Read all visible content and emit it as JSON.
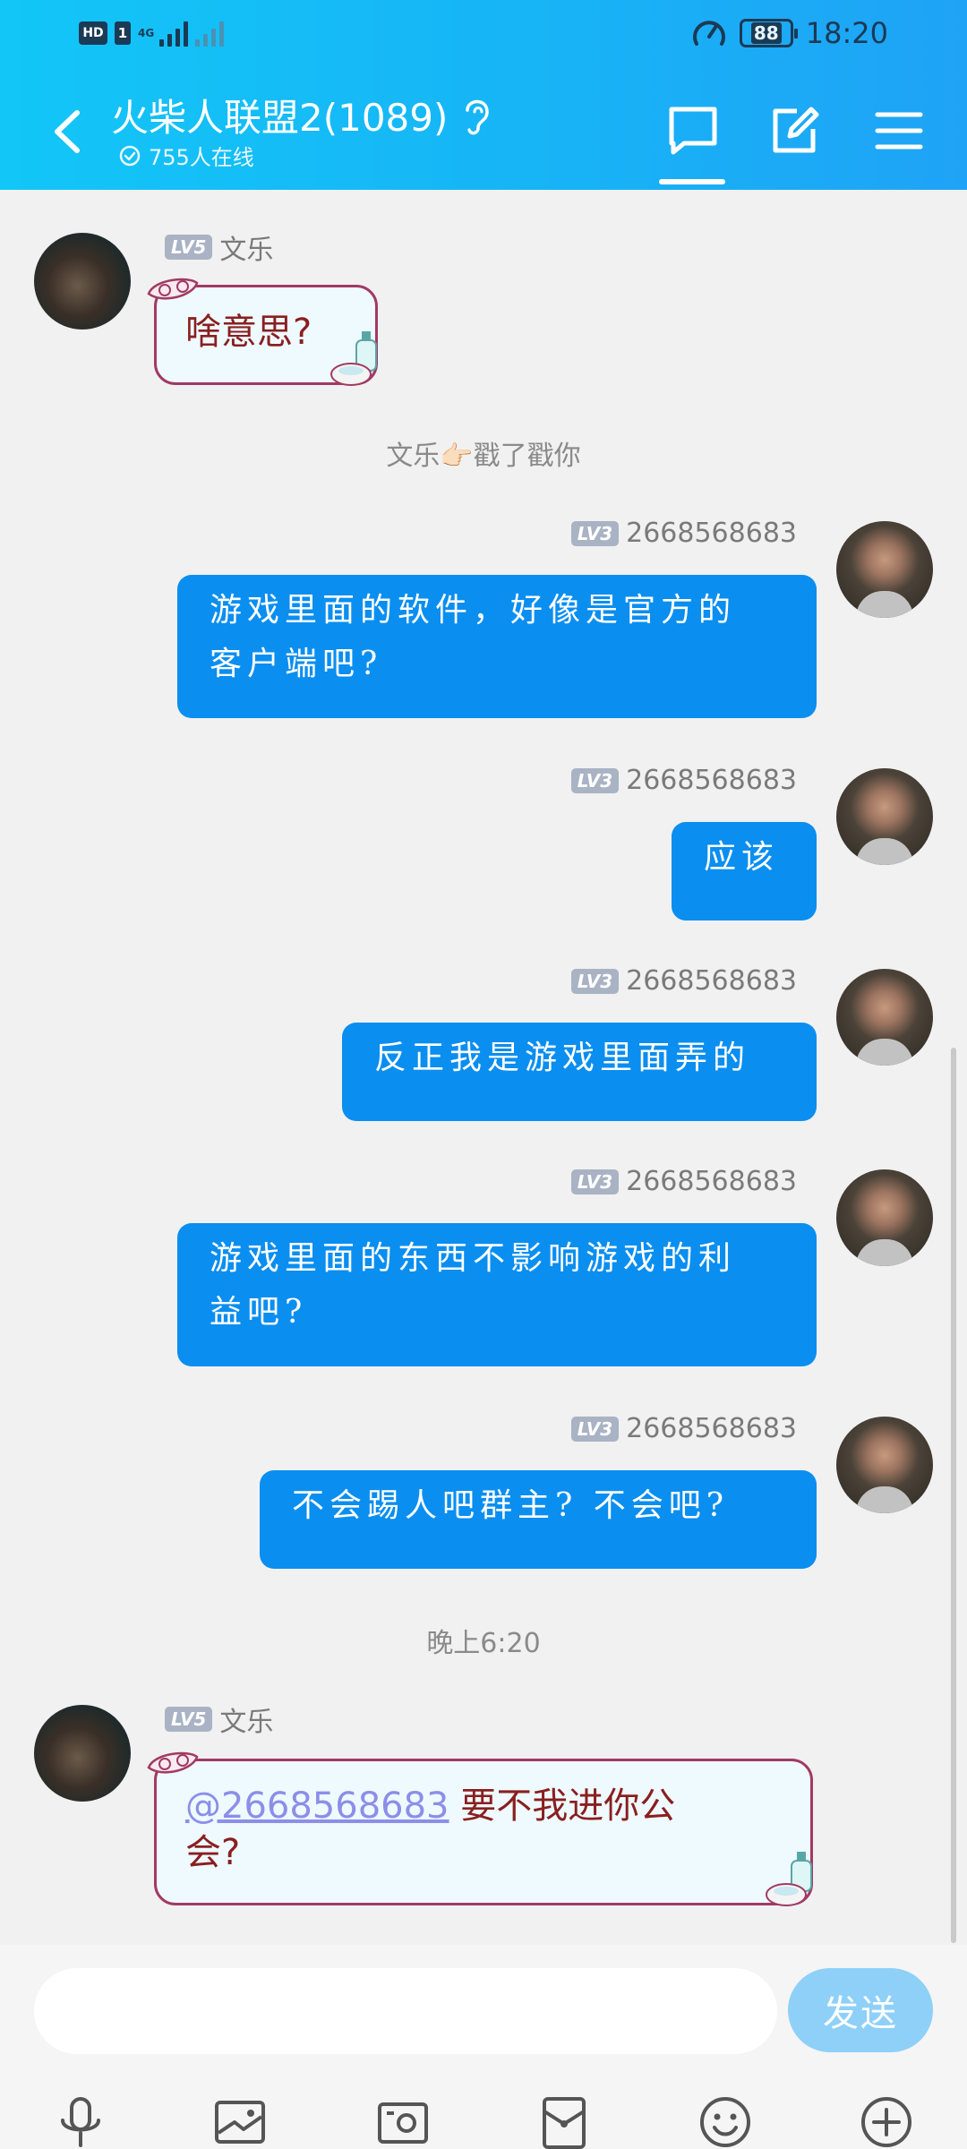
{
  "status_bar": {
    "network": "4G",
    "battery": "88",
    "time": "18:20"
  },
  "header": {
    "title": "火柴人联盟2(1089)",
    "online": "755人在线"
  },
  "messages": [
    {
      "side": "left",
      "level": "LV5",
      "name": "文乐",
      "text": "啥意思?"
    },
    {
      "type": "system",
      "text": "文乐👉🏻戳了戳你"
    },
    {
      "side": "right",
      "level": "LV3",
      "name": "2668568683",
      "lines": [
        "游戏里面的软件，好像是官方的",
        "客户端吧?"
      ]
    },
    {
      "side": "right",
      "level": "LV3",
      "name": "2668568683",
      "lines": [
        "应该"
      ]
    },
    {
      "side": "right",
      "level": "LV3",
      "name": "2668568683",
      "lines": [
        "反正我是游戏里面弄的"
      ]
    },
    {
      "side": "right",
      "level": "LV3",
      "name": "2668568683",
      "lines": [
        "游戏里面的东西不影响游戏的利",
        "益吧?"
      ]
    },
    {
      "side": "right",
      "level": "LV3",
      "name": "2668568683",
      "lines": [
        "不会踢人吧群主? 不会吧?"
      ]
    },
    {
      "type": "system",
      "text": "晚上6:20"
    },
    {
      "side": "left",
      "level": "LV5",
      "name": "文乐",
      "mention": "@2668568683",
      "text1": " 要不我进你公",
      "text2": "会?"
    }
  ],
  "input": {
    "send_label": "发送"
  },
  "icons": [
    "microphone-icon",
    "image-icon",
    "camera-icon",
    "red-packet-icon",
    "emoji-icon",
    "plus-icon"
  ]
}
